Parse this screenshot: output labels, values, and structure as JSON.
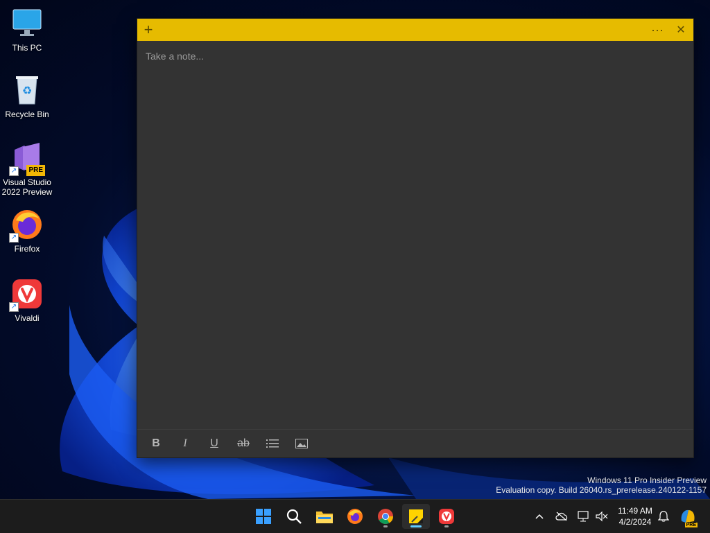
{
  "desktop": {
    "icons": [
      {
        "label": "This PC"
      },
      {
        "label": "Recycle Bin"
      },
      {
        "label": "Visual Studio 2022 Preview",
        "badge": "PRE"
      },
      {
        "label": "Firefox"
      },
      {
        "label": "Vivaldi"
      }
    ]
  },
  "note": {
    "placeholder": "Take a note...",
    "title_buttons": {
      "new": "+",
      "menu": "···",
      "close": "✕"
    },
    "toolbar": [
      "B",
      "I",
      "U",
      "ab",
      "list",
      "image"
    ],
    "title_color": "#e6bb00"
  },
  "watermark": {
    "line1": "Windows 11 Pro Insider Preview",
    "line2": "Evaluation copy. Build 26040.rs_prerelease.240122-1157"
  },
  "taskbar": {
    "apps": [
      "start",
      "search",
      "file-explorer",
      "firefox",
      "chrome",
      "sticky-notes",
      "vivaldi"
    ],
    "clock": {
      "time": "11:49 AM",
      "date": "4/2/2024"
    },
    "copilot_badge": "PRE"
  }
}
